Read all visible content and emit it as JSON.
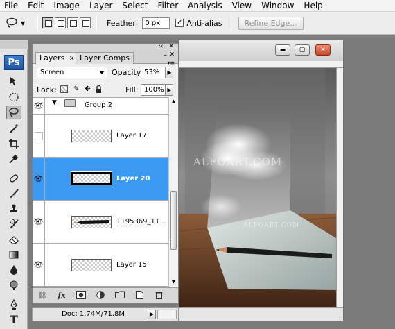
{
  "menu": [
    "File",
    "Edit",
    "Image",
    "Layer",
    "Select",
    "Filter",
    "Analysis",
    "View",
    "Window",
    "Help"
  ],
  "options": {
    "feather_label": "Feather:",
    "feather_value": "0 px",
    "antialias_label": "Anti-alias",
    "antialias_checked": true,
    "refine_edge_label": "Refine Edge..."
  },
  "toolbox": {
    "logo": "Ps",
    "tools": [
      "move-tool",
      "marquee-tool",
      "lasso-tool",
      "magic-wand-tool",
      "crop-tool",
      "eyedropper-tool",
      "healing-brush-tool",
      "brush-tool",
      "clone-stamp-tool",
      "history-brush-tool",
      "eraser-tool",
      "gradient-tool",
      "blur-tool",
      "dodge-tool",
      "pen-tool",
      "type-tool"
    ],
    "active_tool": "lasso-tool",
    "type_tool_glyph": "T"
  },
  "layers_panel": {
    "tabs": [
      "Layers",
      "Layer Comps"
    ],
    "active_tab": "Layers",
    "blend_mode": "Screen",
    "opacity_label": "Opacity:",
    "opacity_value": "53%",
    "lock_label": "Lock:",
    "fill_label": "Fill:",
    "fill_value": "100%",
    "fx_label": "fx",
    "layers": [
      {
        "name": "Group 2",
        "visible": true,
        "type": "group",
        "selected": false
      },
      {
        "name": "Layer 17",
        "visible": false,
        "type": "layer",
        "selected": false
      },
      {
        "name": "Layer 20",
        "visible": true,
        "type": "layer",
        "selected": true
      },
      {
        "name": "1195369_11...",
        "visible": true,
        "type": "layer",
        "selected": false
      },
      {
        "name": "Layer 15",
        "visible": true,
        "type": "layer",
        "selected": false
      }
    ]
  },
  "status": {
    "doc_info": "Doc: 1.74M/71.8M"
  },
  "document": {
    "watermarks": [
      "ALFOART.COM",
      "ALFOART.COM"
    ]
  }
}
